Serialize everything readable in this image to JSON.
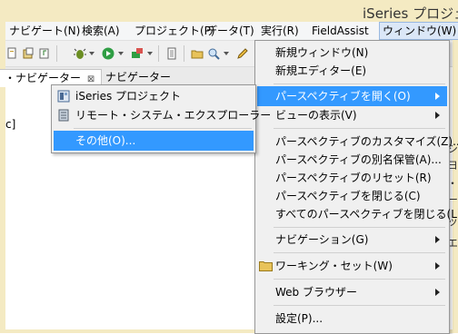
{
  "window": {
    "title": "iSeries プロジェ"
  },
  "menubar": {
    "items": [
      {
        "label": "ナビゲート(N)"
      },
      {
        "label": "検索(A)"
      },
      {
        "label": "プロジェクト(P)"
      },
      {
        "label": "データ(T)"
      },
      {
        "label": "実行(R)"
      },
      {
        "label": "FieldAssist"
      },
      {
        "label": "ウィンドウ(W)"
      }
    ]
  },
  "tabs": {
    "active": {
      "label": "・ナビゲーター",
      "close": "⊠"
    },
    "other": {
      "label": "ナビゲーター"
    }
  },
  "editor": {
    "tree_fragment": "c]"
  },
  "submenu": {
    "items": [
      {
        "label": "iSeries プロジェクト",
        "icon": "iseries-project-icon"
      },
      {
        "label": "リモート・システム・エクスプローラー",
        "icon": "remote-system-explorer-icon"
      }
    ],
    "other": {
      "label": "その他(O)..."
    }
  },
  "window_menu": {
    "items": [
      {
        "label": "新規ウィンドウ(N)"
      },
      {
        "label": "新規エディター(E)"
      },
      {
        "label": "パースペクティブを開く(O)"
      },
      {
        "label": "ビューの表示(V)"
      },
      {
        "label": "パースペクティブのカスタマイズ(Z)..."
      },
      {
        "label": "パースペクティブの別名保管(A)..."
      },
      {
        "label": "パースペクティブのリセット(R)"
      },
      {
        "label": "パースペクティブを閉じる(C)"
      },
      {
        "label": "すべてのパースペクティブを閉じる(L)"
      },
      {
        "label": "ナビゲーション(G)"
      },
      {
        "label": "ワーキング・セット(W)"
      },
      {
        "label": "Web ブラウザー"
      },
      {
        "label": "設定(P)..."
      }
    ]
  },
  "right_peek": [
    "シ",
    "ヨ",
    "・",
    "ー",
    "ッ",
    "エ"
  ],
  "colors": {
    "highlight": "#3399ff",
    "titlebar": "#f4eac2",
    "menu_bg": "#f0f0f0"
  }
}
